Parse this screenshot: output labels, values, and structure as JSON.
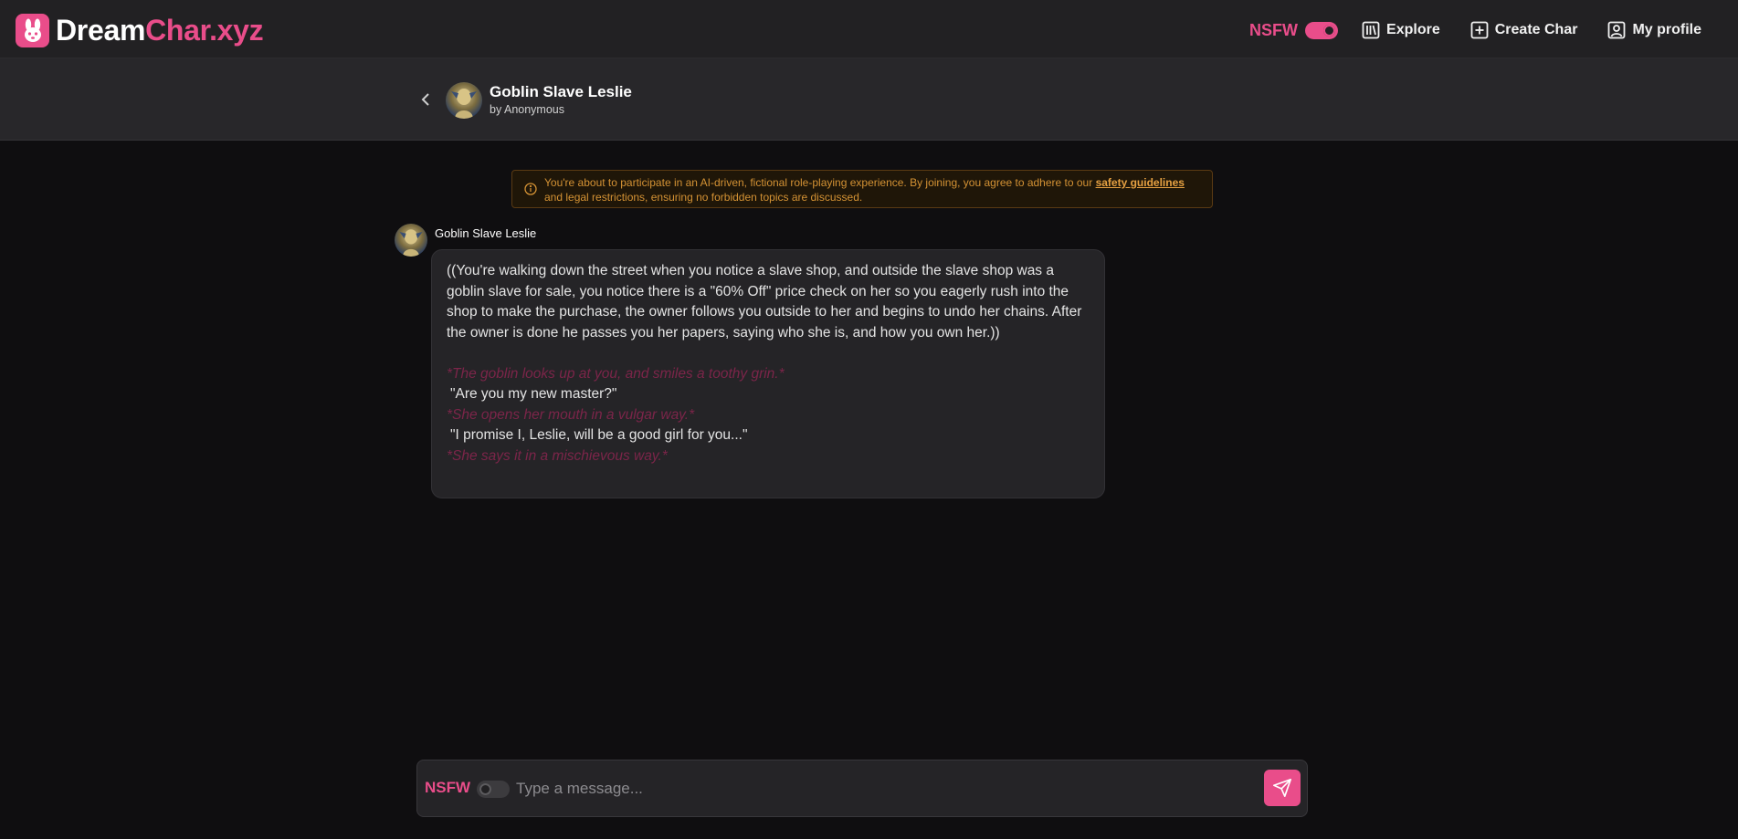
{
  "brand": {
    "name_part1": "Dream",
    "name_part2": "Char.xyz"
  },
  "nav": {
    "nsfw_label": "NSFW",
    "nsfw_enabled": true,
    "explore": "Explore",
    "create_char": "Create Char",
    "my_profile": "My profile"
  },
  "character": {
    "name": "Goblin Slave Leslie",
    "author": "by Anonymous"
  },
  "disclaimer": {
    "text_before": "You're about to participate in an AI-driven, fictional role-playing experience. By joining, you agree to adhere to our ",
    "link": "safety guidelines",
    "text_after": " and legal restrictions, ensuring no forbidden topics are discussed."
  },
  "message": {
    "author": "Goblin Slave Leslie",
    "intro": "((You're walking down the street when you notice a slave shop, and outside the slave shop was a goblin slave for sale, you notice there is a \"60% Off\" price check on her so you eagerly rush into the shop to make the purchase, the owner follows you outside to her and begins to undo her chains. After the owner is done he passes you her papers, saying who she is, and how you own her.))",
    "action1": "*The goblin looks up at you, and smiles a toothy grin.*",
    "quote1": "\"Are you my new master?\"",
    "action2": "*She opens her mouth in a vulgar way.*",
    "quote2": "\"I promise I, Leslie, will be a good girl for you...\"",
    "action3": "*She says it in a mischievous way.*"
  },
  "composer": {
    "nsfw_label": "NSFW",
    "nsfw_enabled": false,
    "placeholder": "Type a message..."
  },
  "colors": {
    "accent": "#e94d8a",
    "warning": "#d49234",
    "action_text": "#7b2549"
  }
}
